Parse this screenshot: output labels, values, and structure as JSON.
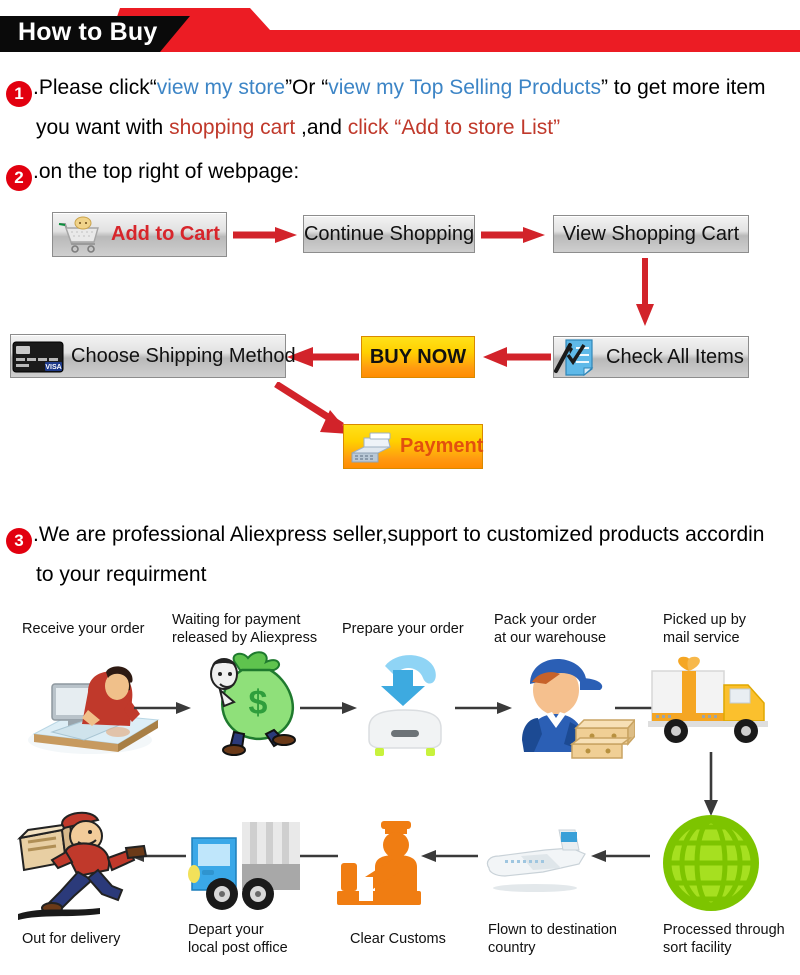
{
  "banner": {
    "title": "How to Buy",
    "black_color": "#0a0a0a",
    "red_color": "#ec1c24"
  },
  "steps": [
    {
      "number": "1",
      "line1_parts": [
        {
          "text": ".Please click“",
          "color": "black"
        },
        {
          "text": "view my store",
          "color": "blue"
        },
        {
          "text": "”Or “",
          "color": "black"
        },
        {
          "text": "view my Top Selling Products",
          "color": "blue"
        },
        {
          "text": "” to get more item",
          "color": "black"
        }
      ],
      "line2_parts": [
        {
          "text": "you want with ",
          "color": "black"
        },
        {
          "text": "shopping cart",
          "color": "red"
        },
        {
          "text": " ,and ",
          "color": "black"
        },
        {
          "text": "click “Add to store List”",
          "color": "red"
        }
      ]
    },
    {
      "number": "2",
      "line1_parts": [
        {
          "text": ".on the top right of webpage:",
          "color": "black"
        }
      ]
    },
    {
      "number": "3",
      "line1_parts": [
        {
          "text": ".We are professional Aliexpress seller,support to customized products accordin",
          "color": "black"
        }
      ],
      "line2_parts": [
        {
          "text": "to your requirment",
          "color": "black"
        }
      ]
    }
  ],
  "buy_flow": {
    "buttons": {
      "add_to_cart": "Add to Cart",
      "continue_shopping": "Continue Shopping",
      "view_shopping_cart": "View Shopping Cart",
      "check_all_items": "Check All Items",
      "buy_now": "BUY NOW",
      "choose_shipping_method": "Choose Shipping Method",
      "payment": "Payment"
    },
    "arrow_color": "#d2232a",
    "icons": {
      "add_to_cart": "shopping-cart-icon",
      "check_all_items": "checklist-pen-icon",
      "choose_shipping_method": "credit-card-visa-icon",
      "payment": "cash-register-icon"
    }
  },
  "shipping_flow": {
    "arrow_color": "#3a3a3a",
    "row_top": [
      {
        "label": "Receive your order",
        "icon": "person-at-computer-icon"
      },
      {
        "label": "Waiting for payment\nreleased by Aliexpress",
        "icon": "money-bag-icon"
      },
      {
        "label": "Prepare your order",
        "icon": "download-arrow-icon"
      },
      {
        "label": "Pack your order\nat our warehouse",
        "icon": "worker-with-boxes-icon"
      },
      {
        "label": "Picked up by\nmail service",
        "icon": "delivery-truck-gift-icon"
      }
    ],
    "row_bottom": [
      {
        "label": "Out for delivery",
        "icon": "running-courier-icon"
      },
      {
        "label": "Depart your\nlocal post office",
        "icon": "blue-truck-icon"
      },
      {
        "label": "Clear Customs",
        "icon": "customs-officer-icon"
      },
      {
        "label": "Flown to destination\ncountry",
        "icon": "airplane-icon"
      },
      {
        "label": "Processed through\nsort facility",
        "icon": "green-globe-icon"
      }
    ]
  }
}
